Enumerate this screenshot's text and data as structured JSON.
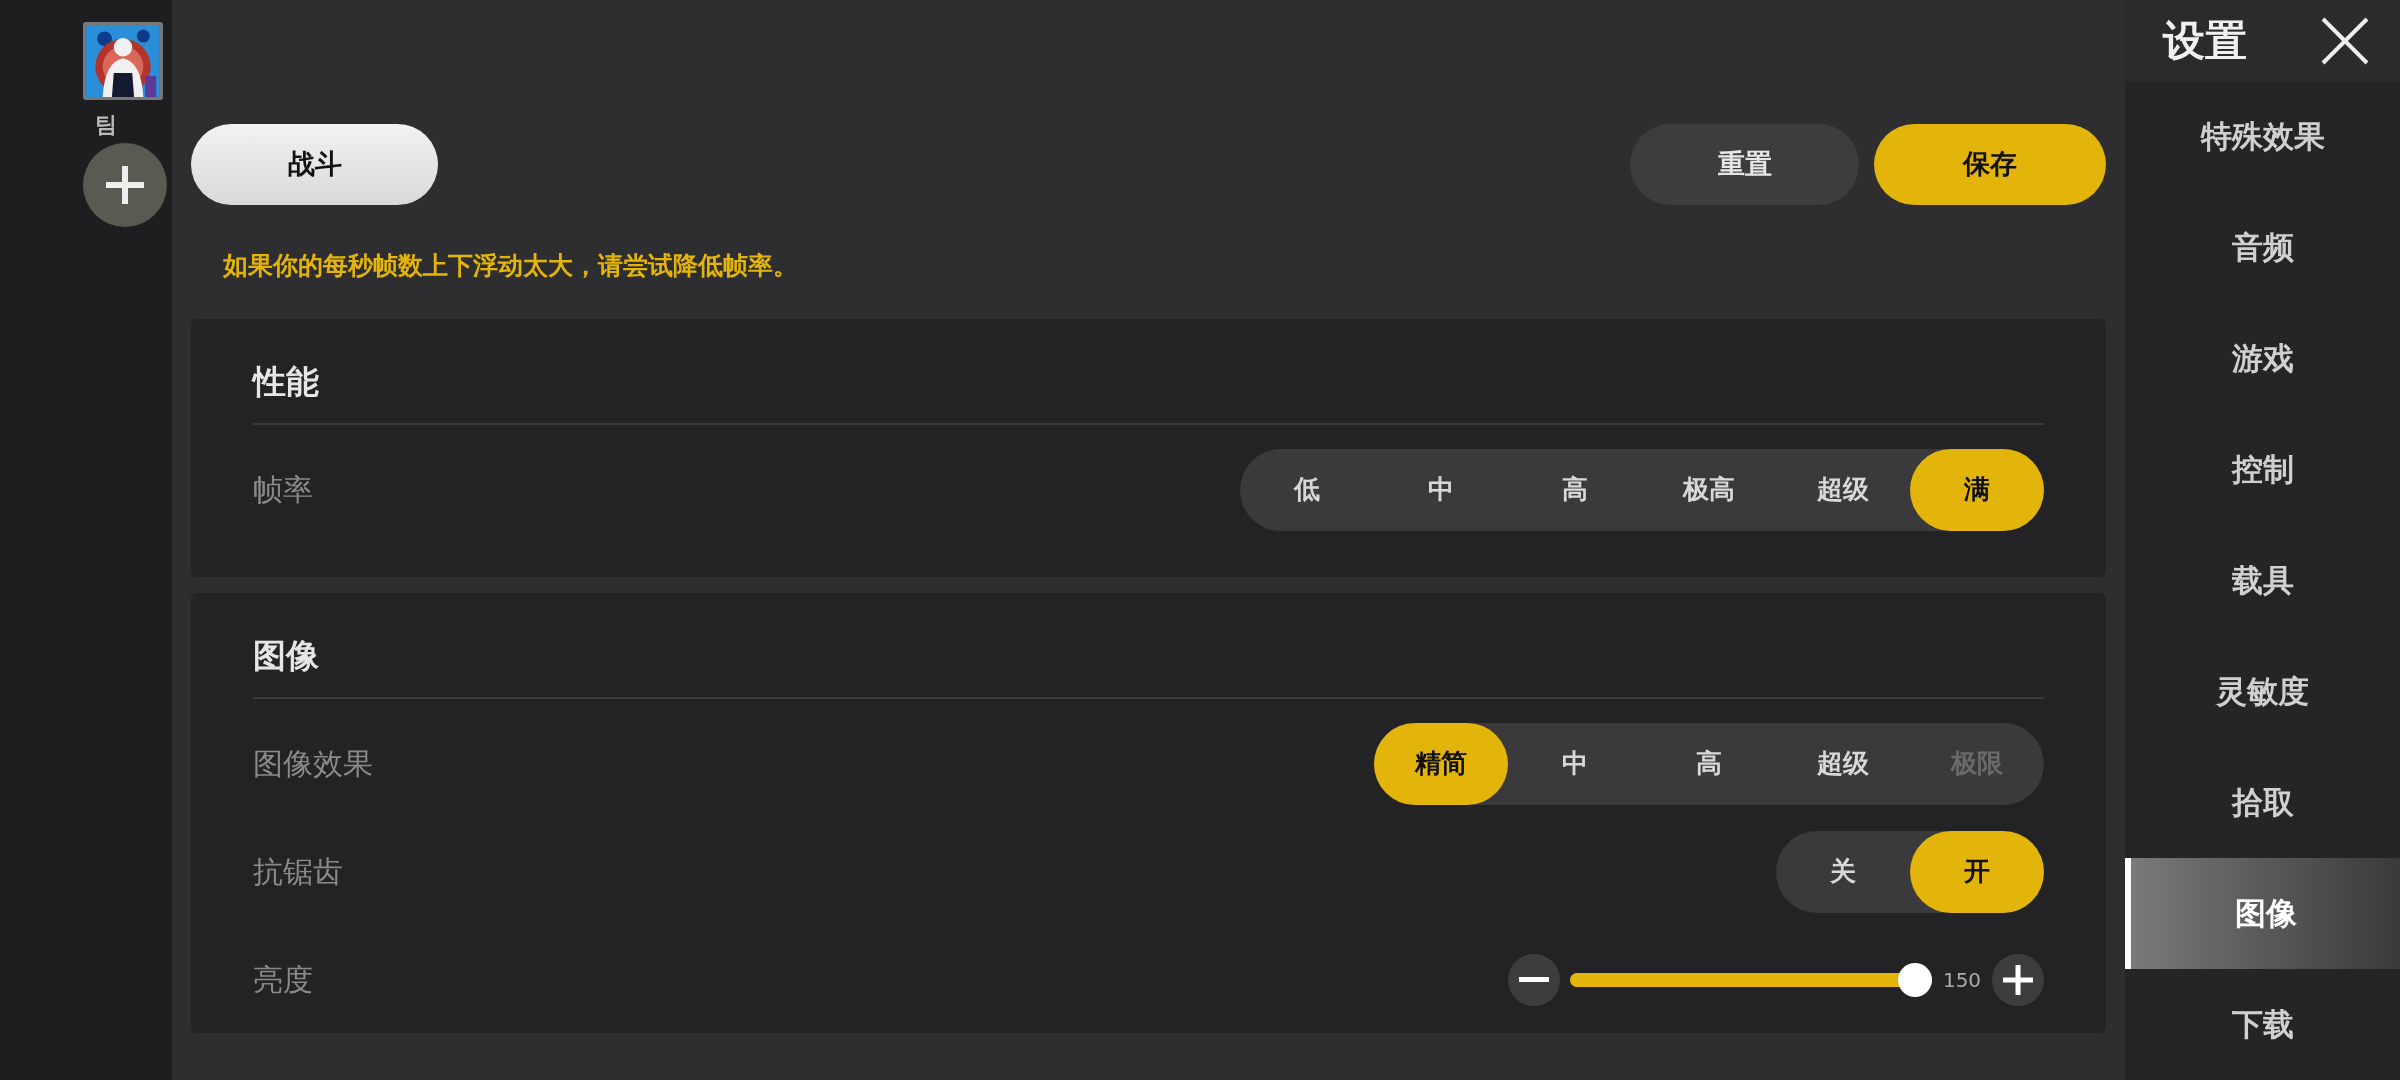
{
  "team": {
    "label": "팀"
  },
  "top_buttons": [
    {
      "label": "战斗",
      "kind": "tab"
    },
    {
      "label": "重置",
      "kind": "secondary"
    },
    {
      "label": "保存",
      "kind": "primary"
    }
  ],
  "notice": "如果你的每秒帧数上下浮动太大，请尝试降低帧率。",
  "sections": [
    {
      "title": "性能",
      "rows": [
        {
          "kind": "segmented",
          "label": "帧率",
          "options": [
            {
              "label": "低",
              "selected": false
            },
            {
              "label": "中",
              "selected": false
            },
            {
              "label": "高",
              "selected": false
            },
            {
              "label": "极高",
              "selected": false
            },
            {
              "label": "超级",
              "selected": false
            },
            {
              "label": "满",
              "selected": true
            }
          ]
        }
      ]
    },
    {
      "title": "图像",
      "rows": [
        {
          "kind": "segmented",
          "label": "图像效果",
          "options": [
            {
              "label": "精简",
              "selected": true,
              "disabled": false
            },
            {
              "label": "中",
              "selected": false,
              "disabled": false
            },
            {
              "label": "高",
              "selected": false,
              "disabled": false
            },
            {
              "label": "超级",
              "selected": false,
              "disabled": false
            },
            {
              "label": "极限",
              "selected": false,
              "disabled": true
            }
          ]
        },
        {
          "kind": "segmented",
          "label": "抗锯齿",
          "options": [
            {
              "label": "关",
              "selected": false
            },
            {
              "label": "开",
              "selected": true
            }
          ]
        },
        {
          "kind": "slider",
          "label": "亮度",
          "level": 1,
          "reading": "150"
        }
      ]
    }
  ],
  "sidebar": {
    "title": "设置",
    "items": [
      {
        "label": "特殊效果",
        "selected": false
      },
      {
        "label": "音频",
        "selected": false
      },
      {
        "label": "游戏",
        "selected": false
      },
      {
        "label": "控制",
        "selected": false
      },
      {
        "label": "载具",
        "selected": false
      },
      {
        "label": "灵敏度",
        "selected": false
      },
      {
        "label": "拾取",
        "selected": false
      },
      {
        "label": "图像",
        "selected": true
      },
      {
        "label": "下载",
        "selected": false
      }
    ]
  }
}
